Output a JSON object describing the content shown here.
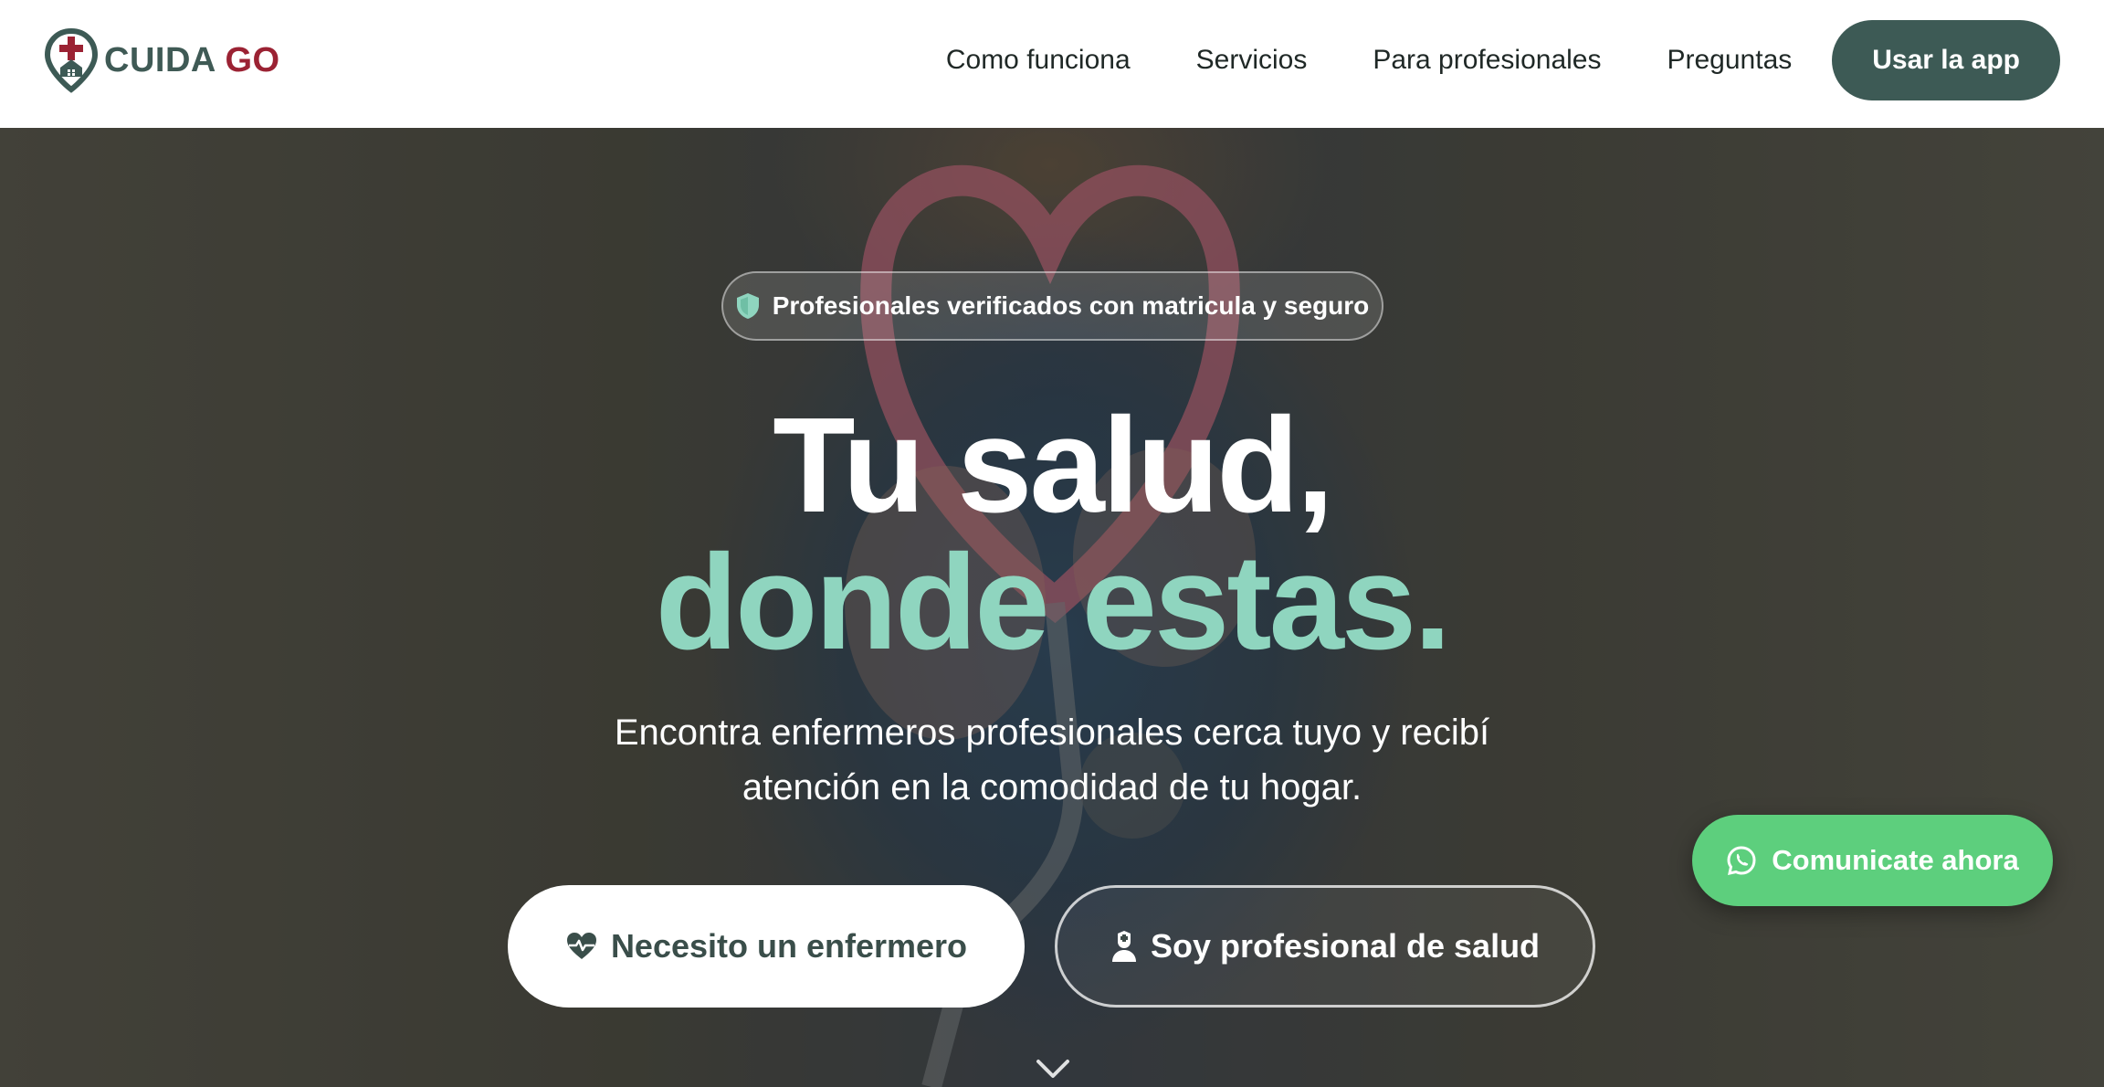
{
  "brand": {
    "name_part1": "CUIDA",
    "name_part2": "GO",
    "logo_icon": "location-pin-cross-icon",
    "colors": {
      "primary": "#3d5a55",
      "accent": "#9b2233",
      "mint": "#8fd5bf",
      "whatsapp": "#5dcf7d"
    }
  },
  "nav": {
    "links": [
      "Como funciona",
      "Servicios",
      "Para profesionales",
      "Preguntas"
    ],
    "cta_label": "Usar la app"
  },
  "hero": {
    "badge_text": "Profesionales verificados con matricula y seguro",
    "badge_icon": "shield-icon",
    "title_line1": "Tu salud,",
    "title_line2": "donde estas.",
    "subtitle_line1": "Encontra enfermeros profesionales cerca tuyo y recibí",
    "subtitle_line2": "atención en la comodidad de tu hogar.",
    "primary_button": {
      "label": "Necesito un enfermero",
      "icon": "heart-pulse-icon"
    },
    "secondary_button": {
      "label": "Soy profesional de salud",
      "icon": "nurse-icon"
    },
    "scroll_icon": "chevron-down-icon"
  },
  "whatsapp_button": {
    "label": "Comunicate ahora",
    "icon": "whatsapp-icon"
  }
}
